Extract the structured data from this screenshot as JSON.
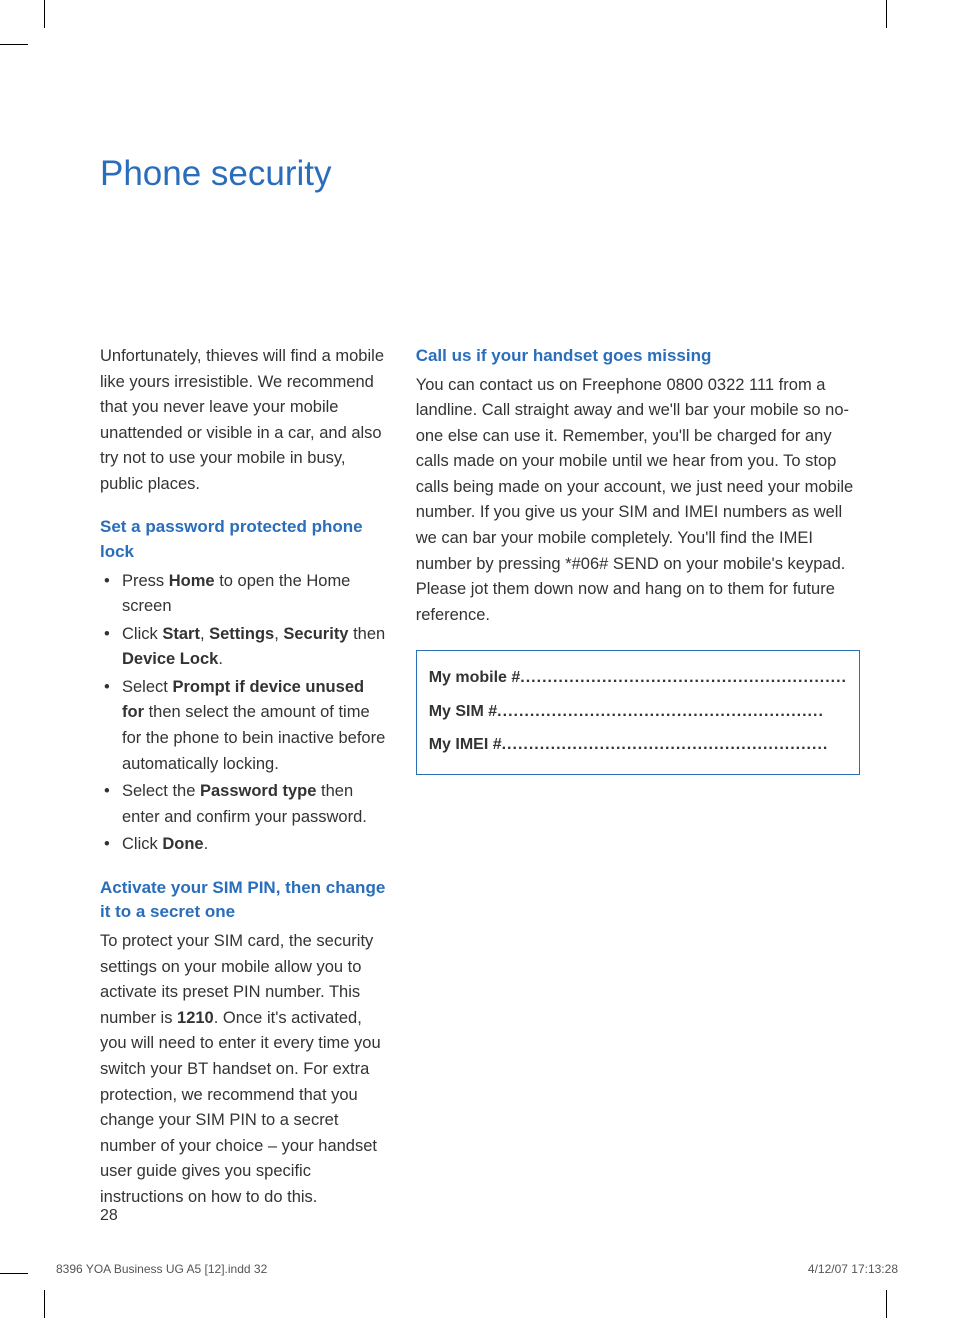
{
  "title": "Phone security",
  "intro": "Unfortunately, thieves will find a mobile like yours irresistible. We recommend that you never leave your mobile unattended or visible in a car, and also try not to use your mobile in busy, public places.",
  "section1_heading": "Set a password protected phone lock",
  "steps": {
    "s1_pre": "Press ",
    "s1_b1": "Home",
    "s1_post": " to open the Home screen",
    "s2_pre": "Click ",
    "s2_b1": "Start",
    "s2_sep1": ", ",
    "s2_b2": "Settings",
    "s2_sep2": ", ",
    "s2_b3": "Security",
    "s2_mid": " then ",
    "s2_b4": "Device Lock",
    "s2_post": ".",
    "s3_pre": "Select ",
    "s3_b1": "Prompt if device unused for",
    "s3_post": " then select the amount of time for the phone to bein inactive before automatically locking.",
    "s4_pre": "Select the ",
    "s4_b1": "Password type",
    "s4_post": " then enter and confirm your password.",
    "s5_pre": "Click ",
    "s5_b1": "Done",
    "s5_post": "."
  },
  "section2_heading": "Activate your SIM PIN, then change it to a secret one",
  "section2_body_pre": "To protect your SIM card, the security settings on your mobile allow you to activate its preset PIN number. This number is ",
  "section2_pin": "1210",
  "section2_body_post": ". Once it's activated, you will need to enter it every time you switch your BT handset on. For extra protection, we recommend that you change your SIM PIN to a secret number of your choice – your handset user guide gives you specific instructions on how to do this.",
  "section3_heading": "Call us if your handset goes missing",
  "section3_body": "You can contact us on Freephone 0800 0322 111 from a landline. Call straight away and we'll bar your mobile so no-one else can use it. Remember, you'll be charged for any calls made on your mobile until we hear from you. To stop calls being made on your account, we just need your mobile number. If you give us your SIM and IMEI numbers as well we can bar your mobile completely. You'll find the IMEI number by pressing *#06# SEND on your mobile's keypad. Please jot them down now and hang on to them for future reference.",
  "info_box": {
    "mobile_label": "My mobile # ",
    "sim_label": "My SIM #",
    "imei_label": "My IMEI # ",
    "dots": "............................................................"
  },
  "page_number": "28",
  "footer_left": "8396 YOA Business UG A5 [12].indd   32",
  "footer_right": "4/12/07   17:13:28"
}
